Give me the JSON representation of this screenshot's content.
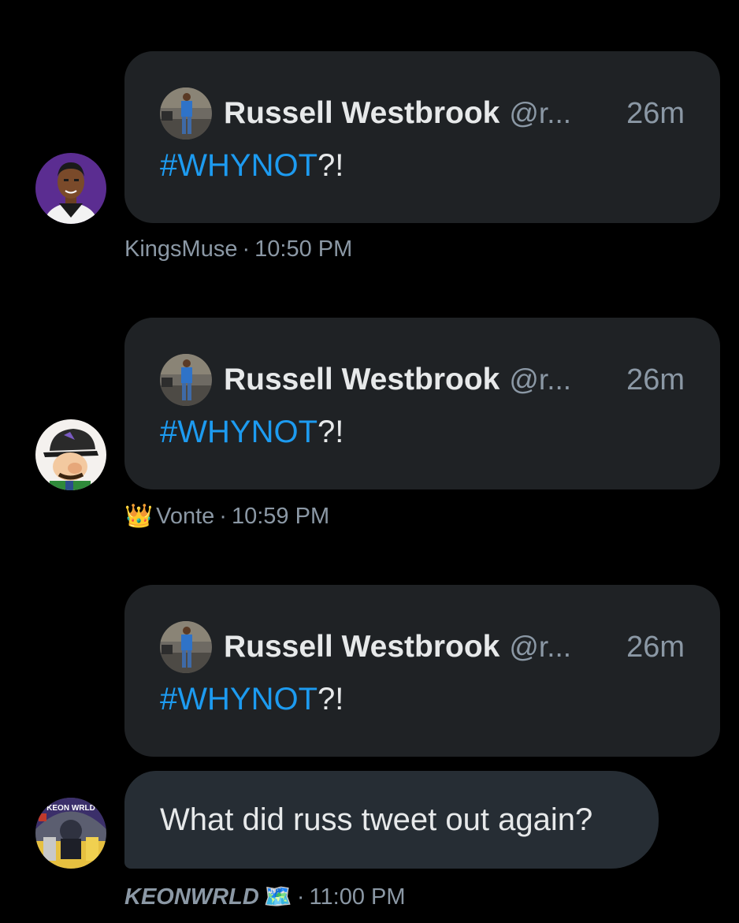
{
  "messages": [
    {
      "type": "quote",
      "quote": {
        "author_name": "Russell Westbrook",
        "author_handle": "@r...",
        "time": "26m",
        "hashtag": "#WHYNOT",
        "suffix": "?!"
      },
      "sender": "KingsMuse",
      "sent_time": "10:50 PM"
    },
    {
      "type": "quote",
      "quote": {
        "author_name": "Russell Westbrook",
        "author_handle": "@r...",
        "time": "26m",
        "hashtag": "#WHYNOT",
        "suffix": "?!"
      },
      "sender_emoji": "👑",
      "sender": "Vonte",
      "sent_time": "10:59 PM"
    },
    {
      "type": "quote",
      "quote": {
        "author_name": "Russell Westbrook",
        "author_handle": "@r...",
        "time": "26m",
        "hashtag": "#WHYNOT",
        "suffix": "?!"
      }
    },
    {
      "type": "text",
      "text": "What did russ tweet out again?",
      "sender": "KEONWRLD",
      "sender_emoji": "🗺️",
      "sent_time": "11:00 PM"
    }
  ],
  "meta_separator": "·",
  "avatar_badge_text": "KEON WRLD",
  "colors": {
    "background": "#000000",
    "card": "#1f2225",
    "bubble": "#262d34",
    "hashtag": "#1d9bf0",
    "secondary_text": "#8b98a5"
  }
}
